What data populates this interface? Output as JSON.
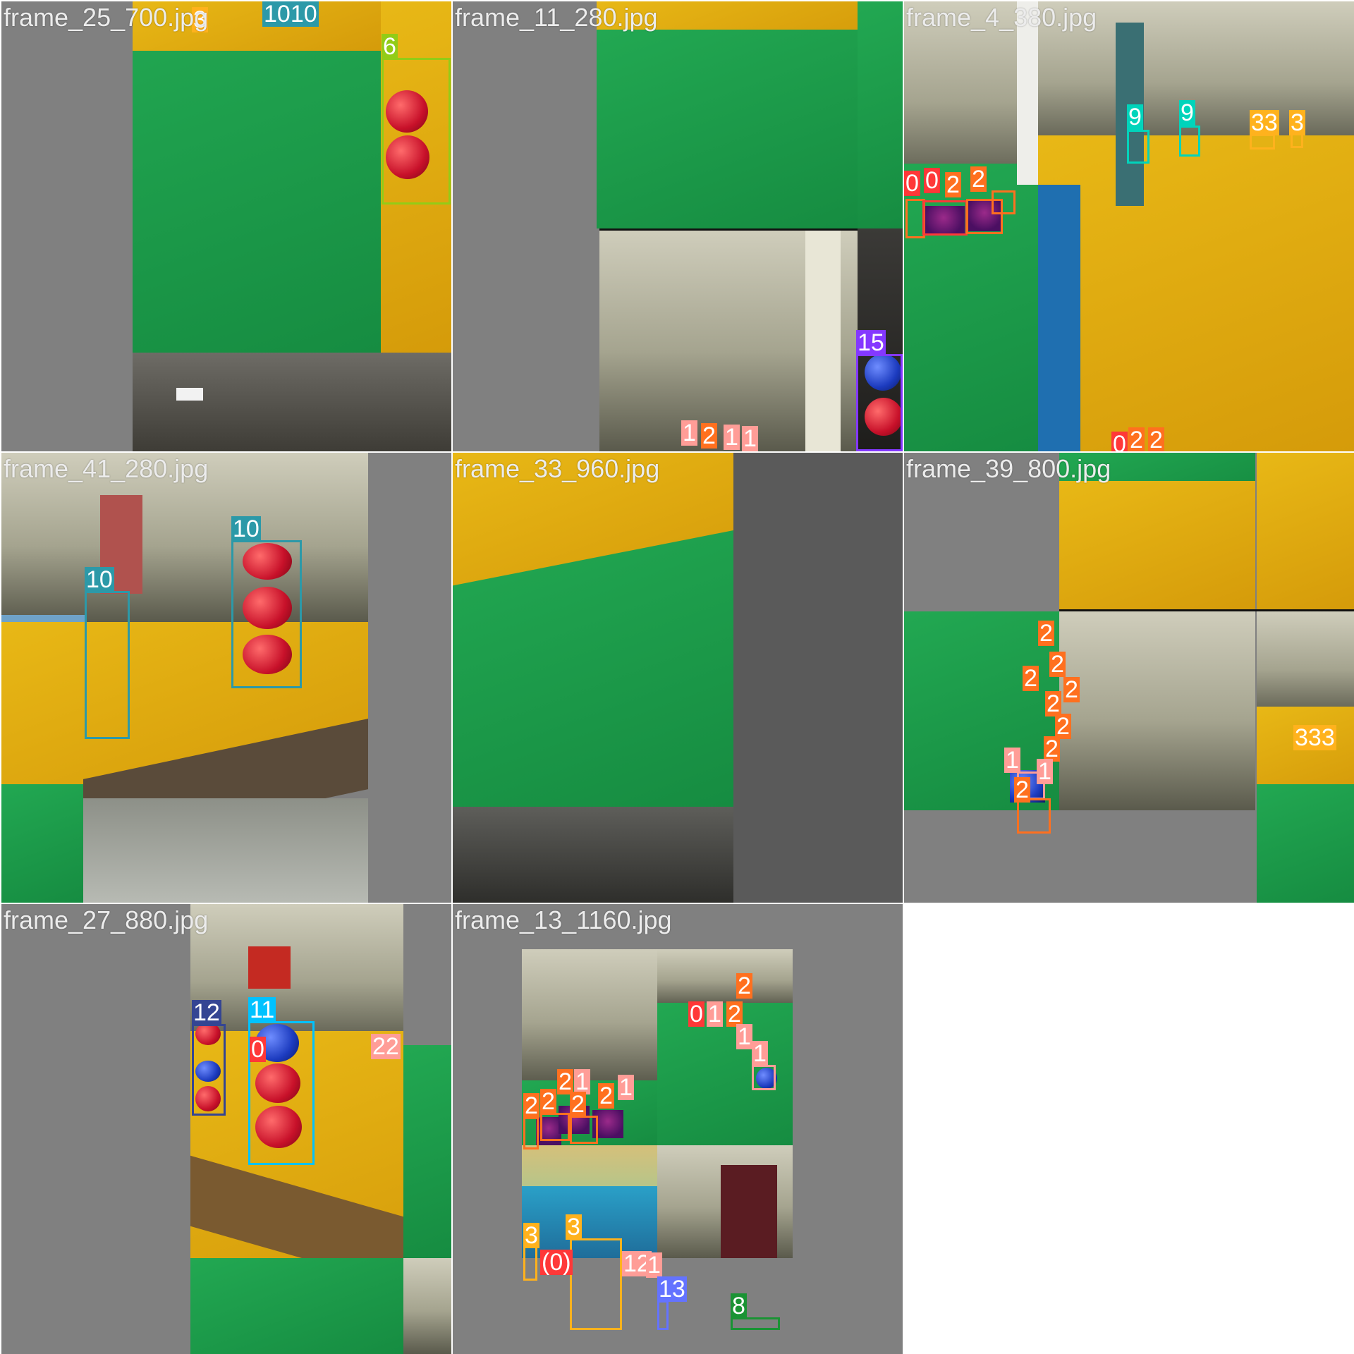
{
  "tiles": [
    {
      "name": "frame_25_700.jpg",
      "labels": [
        "3",
        "1010",
        "6"
      ]
    },
    {
      "name": "frame_11_280.jpg",
      "labels": [
        "1",
        "2",
        "1",
        "1",
        "15"
      ]
    },
    {
      "name": "frame_4_380.jpg",
      "labels": [
        "0",
        "0",
        "2",
        "2",
        "9",
        "9",
        "33",
        "3",
        "0",
        "2",
        "2"
      ]
    },
    {
      "name": "frame_41_280.jpg",
      "labels": [
        "10",
        "10"
      ]
    },
    {
      "name": "frame_33_960.jpg",
      "labels": []
    },
    {
      "name": "frame_39_800.jpg",
      "labels": [
        "2",
        "2",
        "2",
        "2",
        "2",
        "2",
        "2",
        "1",
        "1",
        "2",
        "333"
      ]
    },
    {
      "name": "frame_27_880.jpg",
      "labels": [
        "12",
        "11",
        "0",
        "22"
      ]
    },
    {
      "name": "frame_13_1160.jpg",
      "labels": [
        "0",
        "1",
        "2",
        "2",
        "1",
        "1",
        "2",
        "1",
        "2",
        "2",
        "2",
        "2",
        "1",
        "3",
        "3",
        "(0)",
        "12",
        "1",
        "13",
        "8"
      ]
    }
  ],
  "colors": {
    "class0": "#ff3838",
    "class1": "#ff9d97",
    "class2": "#ff701f",
    "class3": "#ffb21d",
    "class6": "#92cc17",
    "class8": "#1a9334",
    "class9": "#00d4bb",
    "class10": "#2c99a8",
    "class11": "#00c2ff",
    "class12": "#344593",
    "class13": "#6473ff",
    "class15": "#8438ff"
  }
}
